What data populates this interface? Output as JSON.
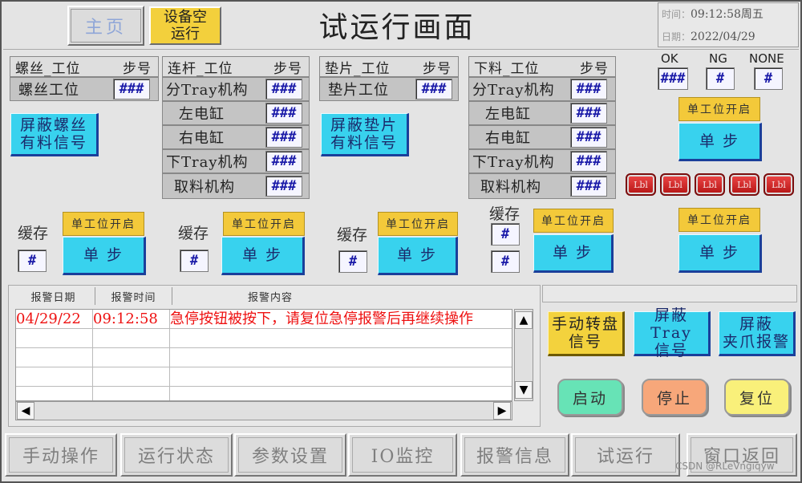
{
  "header": {
    "home_label": "主页",
    "empty_run_label": "设备空\n运行",
    "title": "试运行画面",
    "time_label": "时间：",
    "time_value": "09:12:58周五",
    "date_label": "日期：",
    "date_value": "2022/04/29"
  },
  "stations": {
    "screw": {
      "header": "螺丝_工位",
      "step": "步号",
      "rows": [
        {
          "label": "螺丝工位",
          "value": "###"
        }
      ],
      "shield_button": "屏蔽螺丝\n有料信号"
    },
    "link": {
      "header": "连杆_工位",
      "step": "步号",
      "rows": [
        {
          "label": "分Tray机构",
          "value": "###"
        },
        {
          "label": "左电缸",
          "value": "###"
        },
        {
          "label": "右电缸",
          "value": "###"
        },
        {
          "label": "下Tray机构",
          "value": "###"
        },
        {
          "label": "取料机构",
          "value": "###"
        }
      ]
    },
    "washer": {
      "header": "垫片_工位",
      "step": "步号",
      "rows": [
        {
          "label": "垫片工位",
          "value": "###"
        }
      ],
      "shield_button": "屏蔽垫片\n有料信号"
    },
    "unload": {
      "header": "下料_工位",
      "step": "步号",
      "rows": [
        {
          "label": "分Tray机构",
          "value": "###"
        },
        {
          "label": "左电缸",
          "value": "###"
        },
        {
          "label": "右电缸",
          "value": "###"
        },
        {
          "label": "下Tray机构",
          "value": "###"
        },
        {
          "label": "取料机构",
          "value": "###"
        }
      ]
    }
  },
  "counters": {
    "ok_label": "OK",
    "ok_value": "###",
    "ng_label": "NG",
    "ng_value": "#",
    "none_label": "NONE",
    "none_value": "#"
  },
  "single_station": {
    "tag": "单工位开启",
    "step_button": "单 步"
  },
  "cache": {
    "label": "缓存",
    "value": "#"
  },
  "lbl_buttons": [
    "Lbl",
    "Lbl",
    "Lbl",
    "Lbl",
    "Lbl"
  ],
  "alarm": {
    "col_date": "报警日期",
    "col_time": "报警时间",
    "col_content": "报警内容",
    "rows": [
      {
        "date": "04/29/22",
        "time": "09:12:58",
        "content": "急停按钮被按下，请复位急停报警后再继续操作"
      }
    ]
  },
  "actions": {
    "manual_turntable": "手动转盘\n信号",
    "shield_tray": "屏蔽Tray\n信号",
    "shield_claw": "屏蔽\n夹爪报警",
    "start": "启动",
    "stop": "停止",
    "reset": "复位"
  },
  "nav": [
    "手动操作",
    "运行状态",
    "参数设置",
    "IO监控",
    "报警信息",
    "试运行",
    "窗口返回"
  ],
  "watermark": "CSDN @RLeVngiqyw",
  "colors": {
    "cyan": "#38d2ee",
    "yellow": "#f3d03c",
    "start_green": "#67e3b6",
    "stop_orange": "#f7a77a",
    "reset_yellow": "#f9f07a",
    "alarm_red": "#e11111"
  }
}
